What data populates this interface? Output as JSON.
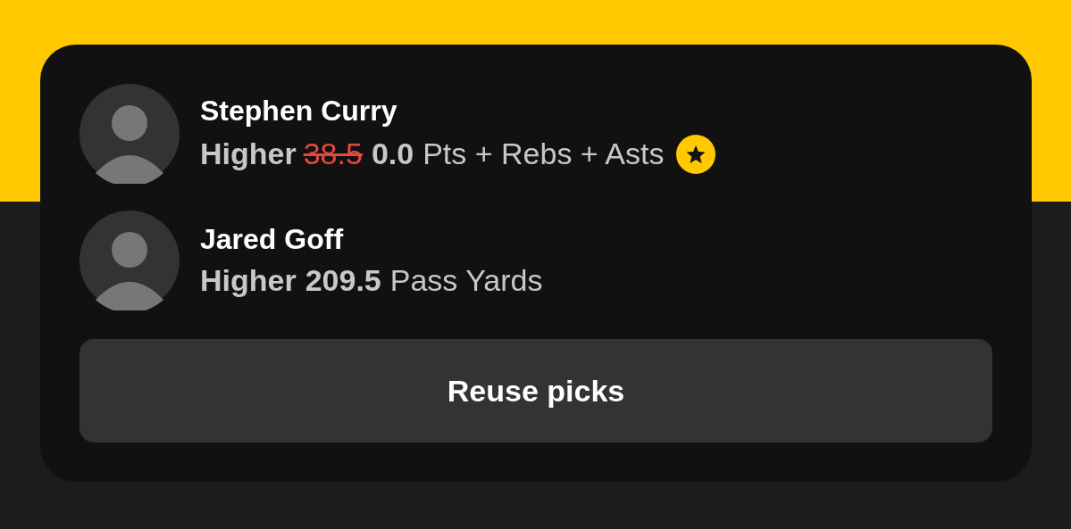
{
  "picks": [
    {
      "name": "Stephen Curry",
      "direction": "Higher",
      "original_line": "38.5",
      "line": "0.0",
      "stat": "Pts + Rebs + Asts",
      "boosted": true
    },
    {
      "name": "Jared Goff",
      "direction": "Higher",
      "line": "209.5",
      "stat": "Pass Yards",
      "boosted": false
    }
  ],
  "button": {
    "label": "Reuse picks"
  }
}
